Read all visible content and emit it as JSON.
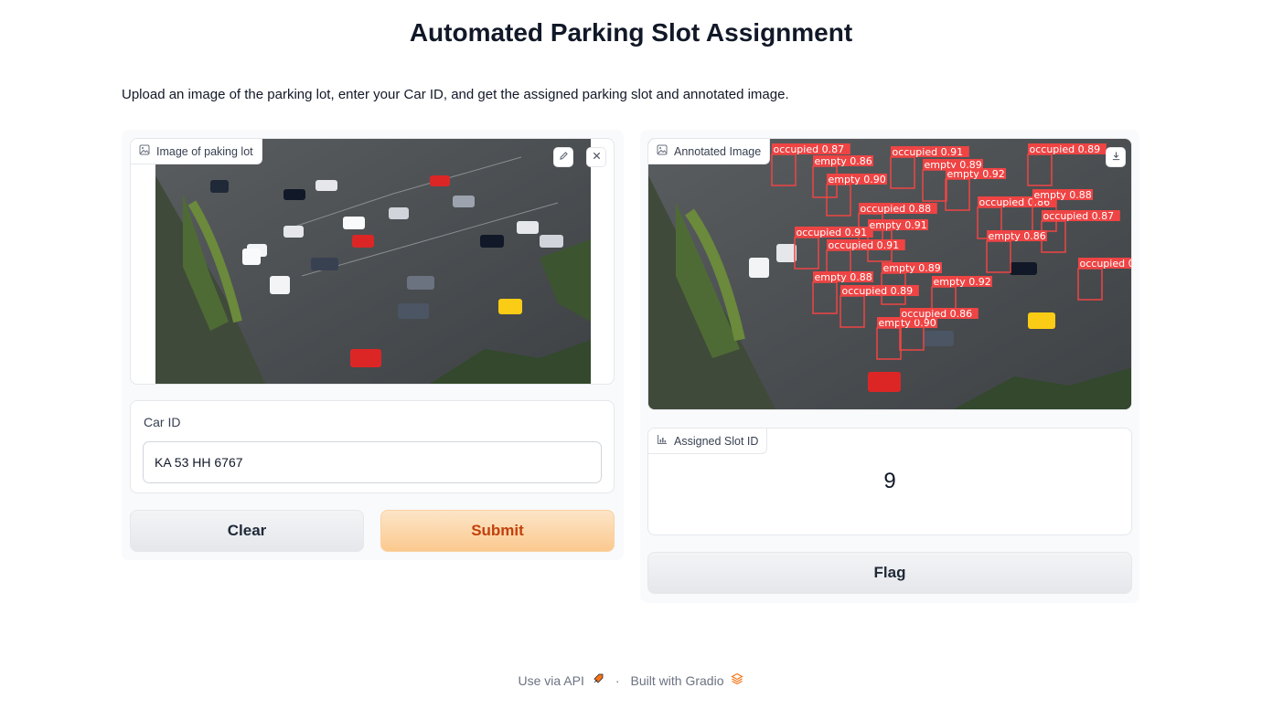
{
  "page": {
    "title": "Automated Parking Slot Assignment",
    "description": "Upload an image of the parking lot, enter your Car ID, and get the assigned parking slot and annotated image."
  },
  "inputs": {
    "image_label": "Image of paking lot",
    "image_icon": "image-icon",
    "edit_icon": "pencil-icon",
    "close_icon": "close-icon",
    "car_id_label": "Car ID",
    "car_id_value": "KA 53 HH 6767"
  },
  "buttons": {
    "clear": "Clear",
    "submit": "Submit",
    "flag": "Flag"
  },
  "outputs": {
    "annotated_label": "Annotated Image",
    "download_icon": "download-icon",
    "slot_label": "Assigned Slot ID",
    "slot_icon": "bar-chart-icon",
    "slot_value": "9",
    "detections": [
      {
        "label": "occupied",
        "score": "0.87"
      },
      {
        "label": "empty",
        "score": "0.86"
      },
      {
        "label": "occupied",
        "score": "0.91"
      },
      {
        "label": "empty",
        "score": "0.89"
      },
      {
        "label": "occupied",
        "score": "0.89"
      },
      {
        "label": "empty",
        "score": "0.90"
      },
      {
        "label": "empty",
        "score": "0.92"
      },
      {
        "label": "occupied",
        "score": "0.88"
      },
      {
        "label": "occupied",
        "score": "0.86"
      },
      {
        "label": "empty",
        "score": "0.88"
      },
      {
        "label": "occupied",
        "score": "0.91"
      },
      {
        "label": "empty",
        "score": "0.91"
      }
    ]
  },
  "footer": {
    "api_text": "Use via API",
    "separator": "·",
    "built_text": "Built with Gradio"
  },
  "colors": {
    "accent": "#f97316",
    "detection_box": "#ef4444",
    "submit_text": "#c2410c"
  }
}
